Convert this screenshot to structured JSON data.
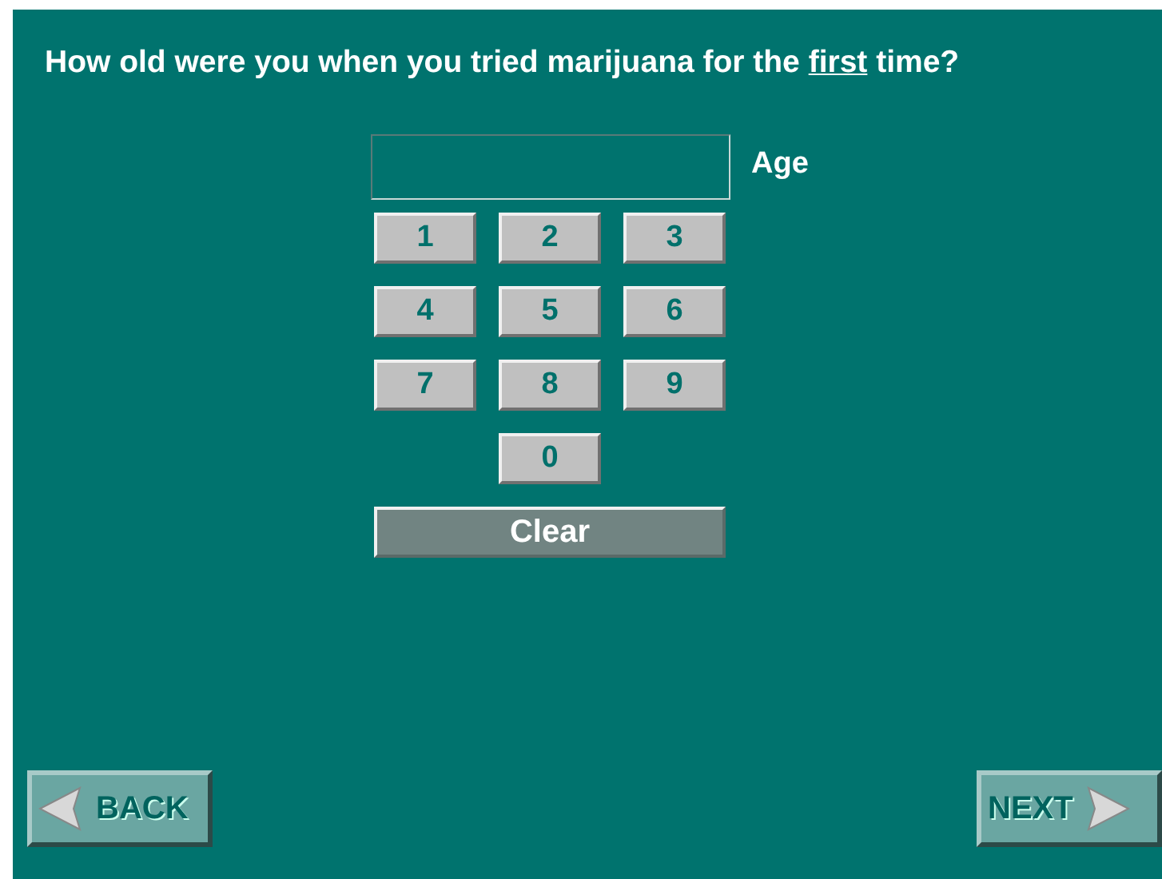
{
  "question": "How old were you when you tried marijuana for the *first* time?",
  "answer_field": {
    "label": "Age"
  },
  "keypad": {
    "keys": [
      "1",
      "2",
      "3",
      "4",
      "5",
      "6",
      "7",
      "8",
      "9",
      "0"
    ],
    "clear_button": "Clear"
  },
  "navigation": {
    "back_button": "BACK",
    "next_button": "NEXT"
  }
}
